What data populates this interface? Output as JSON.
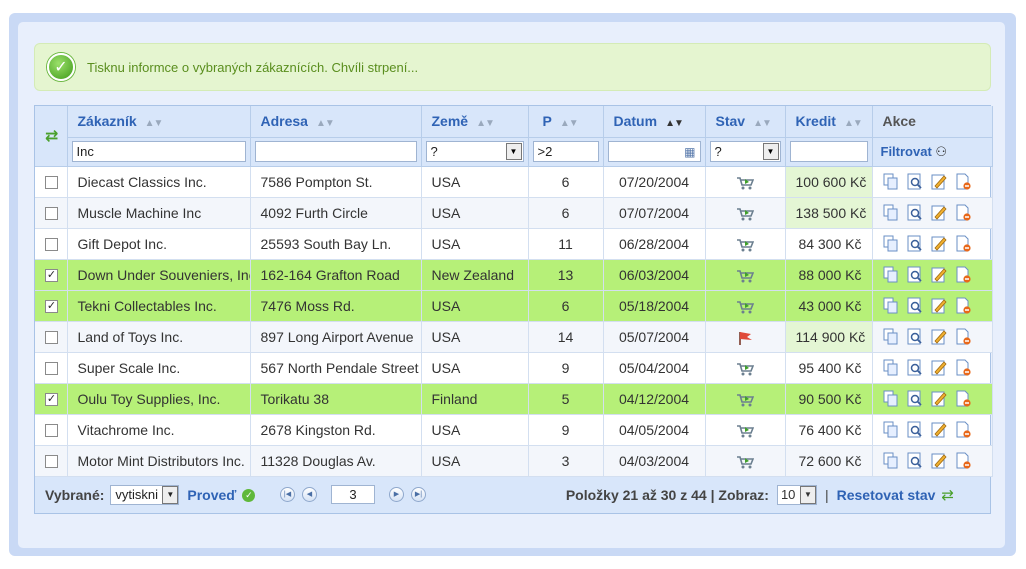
{
  "notice": {
    "message": "Tisknu informce o vybraných zákaznících. Chvíli strpení..."
  },
  "columns": [
    {
      "label": "Zákazník"
    },
    {
      "label": "Adresa"
    },
    {
      "label": "Země"
    },
    {
      "label": "P"
    },
    {
      "label": "Datum"
    },
    {
      "label": "Stav"
    },
    {
      "label": "Kredit"
    },
    {
      "label": "Akce"
    }
  ],
  "filters": {
    "customer": "Inc",
    "address": "",
    "country": "?",
    "p": ">2",
    "date": "",
    "stav": "?",
    "credit": "",
    "apply_label": "Filtrovat"
  },
  "rows": [
    {
      "checked": false,
      "customer": "Diecast Classics Inc.",
      "address": "7586 Pompton St.",
      "country": "USA",
      "p": "6",
      "date": "07/20/2004",
      "status": "cart",
      "credit": "100 600 Kč",
      "credit_high": true
    },
    {
      "checked": false,
      "customer": "Muscle Machine Inc",
      "address": "4092 Furth Circle",
      "country": "USA",
      "p": "6",
      "date": "07/07/2004",
      "status": "cart",
      "credit": "138 500 Kč",
      "credit_high": true
    },
    {
      "checked": false,
      "customer": "Gift Depot Inc.",
      "address": "25593 South Bay Ln.",
      "country": "USA",
      "p": "11",
      "date": "06/28/2004",
      "status": "cart",
      "credit": "84 300 Kč",
      "credit_high": false
    },
    {
      "checked": true,
      "customer": "Down Under Souveniers, Inc",
      "address": "162-164 Grafton Road",
      "country": "New Zealand",
      "p": "13",
      "date": "06/03/2004",
      "status": "cart",
      "credit": "88 000 Kč",
      "credit_high": false
    },
    {
      "checked": true,
      "customer": "Tekni Collectables Inc.",
      "address": "7476 Moss Rd.",
      "country": "USA",
      "p": "6",
      "date": "05/18/2004",
      "status": "cart",
      "credit": "43 000 Kč",
      "credit_high": false
    },
    {
      "checked": false,
      "customer": "Land of Toys Inc.",
      "address": "897 Long Airport Avenue",
      "country": "USA",
      "p": "14",
      "date": "05/07/2004",
      "status": "flag",
      "credit": "114 900 Kč",
      "credit_high": true
    },
    {
      "checked": false,
      "customer": "Super Scale Inc.",
      "address": "567 North Pendale Street",
      "country": "USA",
      "p": "9",
      "date": "05/04/2004",
      "status": "cart",
      "credit": "95 400 Kč",
      "credit_high": false
    },
    {
      "checked": true,
      "customer": "Oulu Toy Supplies, Inc.",
      "address": "Torikatu 38",
      "country": "Finland",
      "p": "5",
      "date": "04/12/2004",
      "status": "cart",
      "credit": "90 500 Kč",
      "credit_high": false
    },
    {
      "checked": false,
      "customer": "Vitachrome Inc.",
      "address": "2678 Kingston Rd.",
      "country": "USA",
      "p": "9",
      "date": "04/05/2004",
      "status": "cart",
      "credit": "76 400 Kč",
      "credit_high": false
    },
    {
      "checked": false,
      "customer": "Motor Mint Distributors Inc.",
      "address": "11328 Douglas Av.",
      "country": "USA",
      "p": "3",
      "date": "04/03/2004",
      "status": "cart",
      "credit": "72 600 Kč",
      "credit_high": false
    }
  ],
  "footer": {
    "selected_label": "Vybrané:",
    "action_value": "vytiskni",
    "execute_label": "Proveď",
    "page": "3",
    "items_info": "Položky 21 až 30 z 44 | Zobraz:",
    "per_page": "10",
    "separator": "|",
    "reset_label": "Resetovat stav"
  },
  "colors": {
    "selected_row": "#b6f078",
    "header_bg": "#d8e6fa",
    "link": "#2f63b5",
    "credit_highlight": "#e4f6d4"
  }
}
